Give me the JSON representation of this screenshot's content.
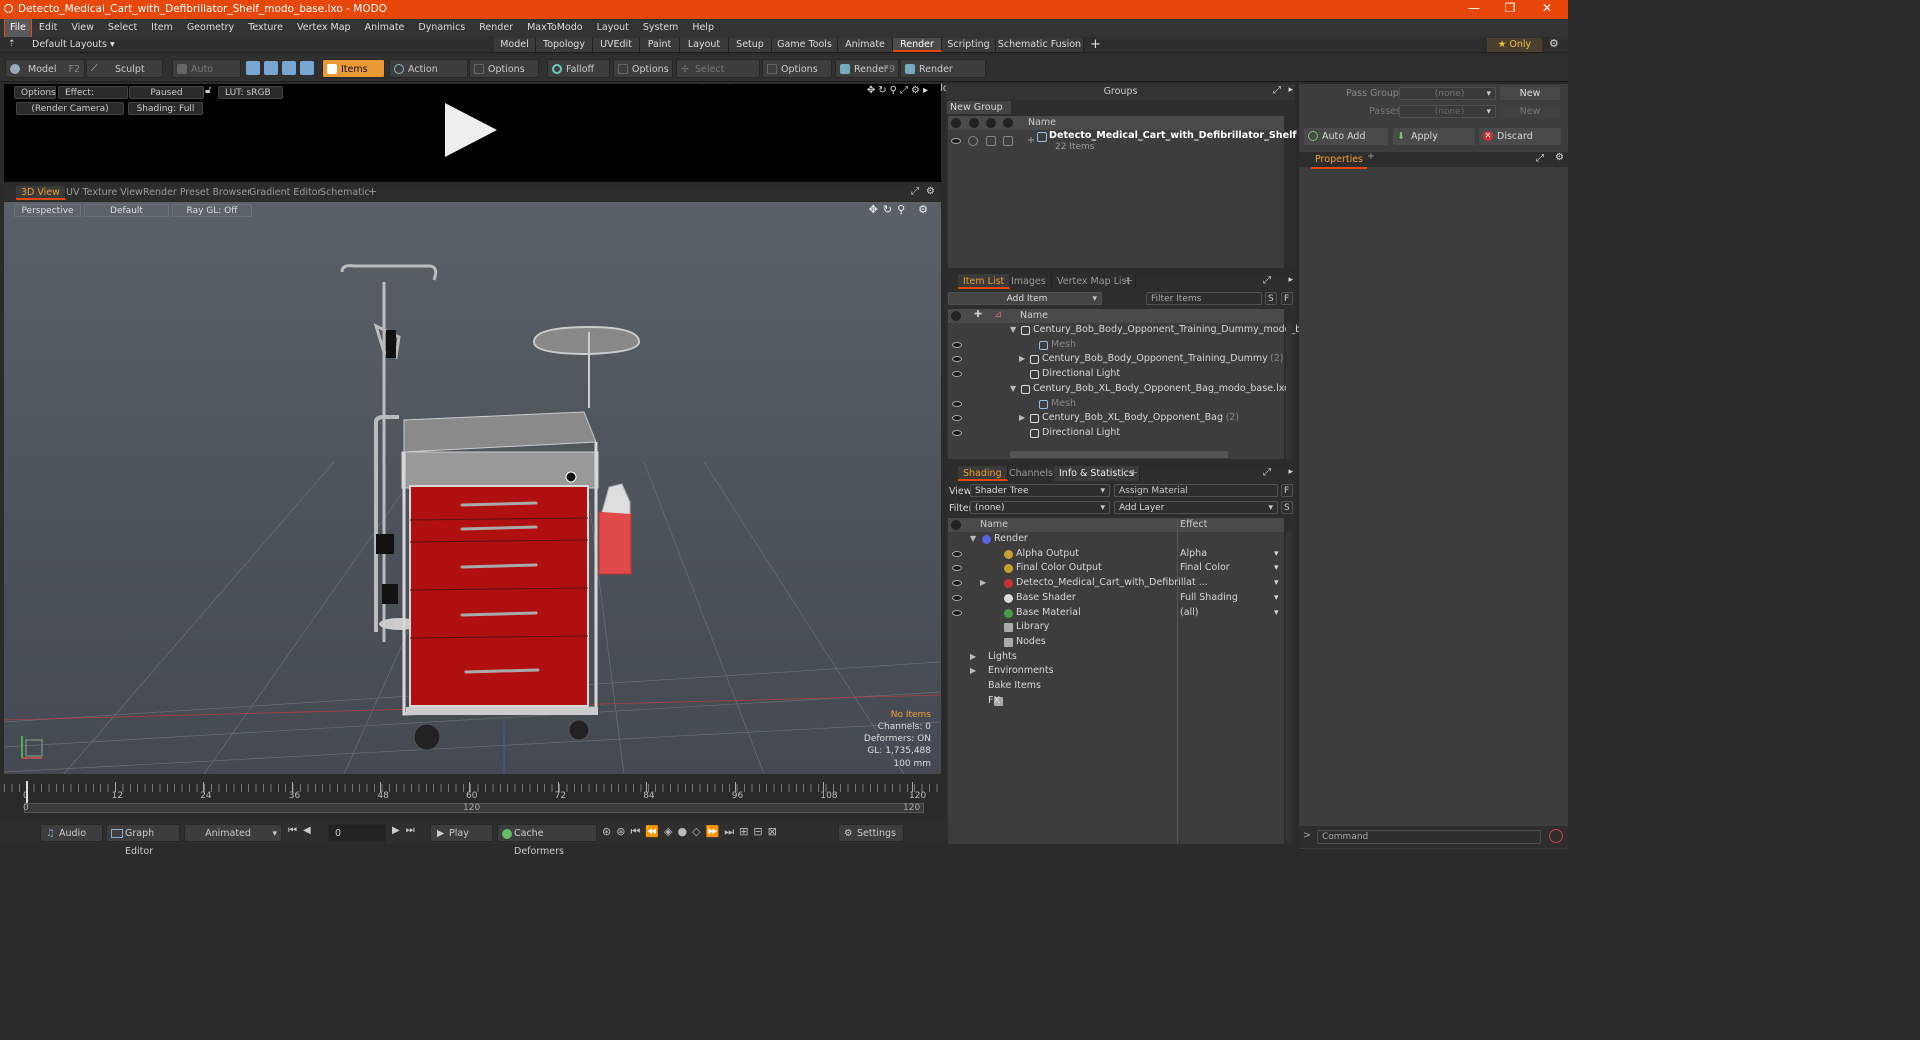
{
  "title": "Detecto_Medical_Cart_with_Defibrillator_Shelf_modo_base.lxo - MODO",
  "window_controls": [
    "—",
    "❐",
    "✕"
  ],
  "menu": [
    "File",
    "Edit",
    "View",
    "Select",
    "Item",
    "Geometry",
    "Texture",
    "Vertex Map",
    "Animate",
    "Dynamics",
    "Render",
    "MaxToModo",
    "Layout",
    "System",
    "Help"
  ],
  "layouts": {
    "default": "Default Layouts ▾",
    "tabs": [
      "Model",
      "Topology",
      "UVEdit",
      "Paint",
      "Layout",
      "Setup",
      "Game Tools",
      "Animate",
      "Render",
      "Scripting",
      "Schematic Fusion"
    ],
    "active": "Render",
    "only": "★ Only"
  },
  "toolbar": {
    "model": "Model",
    "model_key": "F2",
    "sculpt": "Sculpt",
    "auto_select": "Auto Select",
    "items": "Items",
    "action_center": "Action Center",
    "options1": "Options",
    "falloff": "Falloff",
    "options2": "Options",
    "select_through": "Select Through",
    "options3": "Options",
    "render": "Render",
    "render_key": "F9",
    "render_window": "Render Window"
  },
  "preview": {
    "options": "Options",
    "effect": "Effect: (Shadi...",
    "paused": "Paused",
    "lut": "LUT: sRGB",
    "camera": "(Render Camera)",
    "shading": "Shading: Full"
  },
  "view_tabs": [
    "3D View",
    "UV Texture View",
    "Render Preset Browser",
    "Gradient Editor",
    "Schematic"
  ],
  "viewport": {
    "perspective": "Perspective",
    "default": "Default",
    "raygl": "Ray GL: Off",
    "stats": [
      "No Items",
      "Channels: 0",
      "Deformers: ON",
      "GL: 1,735,488",
      "100 mm"
    ]
  },
  "timeline": {
    "ticks": [
      "0",
      "12",
      "24",
      "36",
      "48",
      "60",
      "72",
      "84",
      "96",
      "108",
      "120"
    ],
    "sub": [
      "0",
      "120",
      "120"
    ]
  },
  "bottombar": {
    "audio": "Audio",
    "graph_editor": "Graph Editor",
    "animated": "Animated",
    "frame": "0",
    "play": "Play",
    "cache_deformers": "Cache Deformers",
    "settings": "Settings"
  },
  "groups": {
    "header": "Groups",
    "new_group": "New Group",
    "col_name": "Name",
    "item_name": "Detecto_Medical_Cart_with_Defibrillator_Shelf",
    "item_count": "22 Items"
  },
  "itemlist": {
    "tabs": [
      "Item List",
      "Images",
      "Vertex Map List"
    ],
    "add_item": "Add Item",
    "filter": "Filter Items",
    "col_name": "Name",
    "rows": [
      {
        "label": "Century_Bob_Body_Opponent_Training_Dummy_modo_ba...",
        "indent": 0,
        "arrow": "▼",
        "dim": false
      },
      {
        "label": "Mesh",
        "indent": 2,
        "arrow": "",
        "dim": true
      },
      {
        "label": "Century_Bob_Body_Opponent_Training_Dummy",
        "extra": "(2)",
        "indent": 1,
        "arrow": "▶",
        "dim": false
      },
      {
        "label": "Directional Light",
        "indent": 1,
        "arrow": "",
        "dim": false
      },
      {
        "label": "Century_Bob_XL_Body_Opponent_Bag_modo_base.lxo",
        "indent": 0,
        "arrow": "▼",
        "dim": false
      },
      {
        "label": "Mesh",
        "indent": 2,
        "arrow": "",
        "dim": true
      },
      {
        "label": "Century_Bob_XL_Body_Opponent_Bag",
        "extra": "(2)",
        "indent": 1,
        "arrow": "▶",
        "dim": false
      },
      {
        "label": "Directional Light",
        "indent": 1,
        "arrow": "",
        "dim": false
      }
    ]
  },
  "shading": {
    "tabs": [
      "Shading",
      "Channels",
      "Info & Statistics"
    ],
    "view_label": "View",
    "view_value": "Shader Tree",
    "assign": "Assign Material",
    "filter_label": "Filter",
    "filter_value": "(none)",
    "add_layer": "Add Layer",
    "col_name": "Name",
    "col_effect": "Effect",
    "rows": [
      {
        "label": "Render",
        "effect": "",
        "indent": 0,
        "arrow": "▼",
        "eye": false
      },
      {
        "label": "Alpha Output",
        "effect": "Alpha",
        "indent": 1,
        "arrow": "",
        "eye": true
      },
      {
        "label": "Final Color Output",
        "effect": "Final Color",
        "indent": 1,
        "arrow": "",
        "eye": true
      },
      {
        "label": "Detecto_Medical_Cart_with_Defibrillat ...",
        "effect": "",
        "indent": 1,
        "arrow": "▶",
        "eye": true
      },
      {
        "label": "Base Shader",
        "effect": "Full Shading",
        "indent": 1,
        "arrow": "",
        "eye": true
      },
      {
        "label": "Base Material",
        "effect": "(all)",
        "indent": 1,
        "arrow": "",
        "eye": true
      },
      {
        "label": "Library",
        "effect": "",
        "indent": 1,
        "arrow": "",
        "eye": false
      },
      {
        "label": "Nodes",
        "effect": "",
        "indent": 1,
        "arrow": "",
        "eye": false
      },
      {
        "label": "Lights",
        "effect": "",
        "indent": 0,
        "arrow": "▶",
        "eye": false
      },
      {
        "label": "Environments",
        "effect": "",
        "indent": 0,
        "arrow": "▶",
        "eye": false
      },
      {
        "label": "Bake Items",
        "effect": "",
        "indent": 0,
        "arrow": "",
        "eye": false
      },
      {
        "label": "FX",
        "effect": "",
        "indent": 0,
        "arrow": "",
        "eye": false
      }
    ]
  },
  "passes": {
    "pass_groups": "Pass Groups",
    "passes": "Passes",
    "none": "(none)",
    "new": "New",
    "auto_add": "Auto Add",
    "apply": "Apply",
    "discard": "Discard",
    "properties": "Properties"
  },
  "command": "Command",
  "colors": {
    "accent": "#e8470c",
    "orange": "#f0a030",
    "cart_red": "#b01010"
  }
}
